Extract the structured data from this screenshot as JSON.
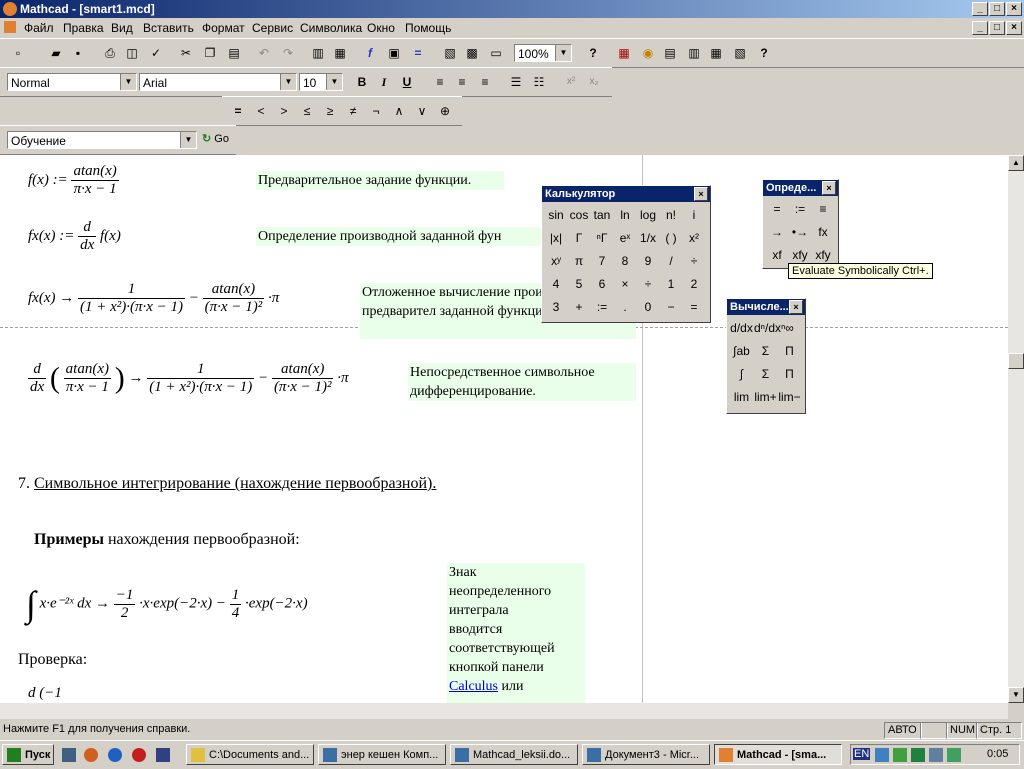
{
  "window": {
    "title": "Mathcad - [smart1.mcd]",
    "min": "_",
    "max": "□",
    "close": "×"
  },
  "menu": [
    "Файл",
    "Правка",
    "Вид",
    "Вставить",
    "Формат",
    "Сервис",
    "Символика",
    "Окно",
    "Помощь"
  ],
  "toolbar": {
    "zoom": "100%",
    "style": "Normal",
    "font": "Arial",
    "size": "10",
    "bold": "B",
    "italic": "I",
    "underline": "U",
    "ops": [
      "=",
      "<",
      ">",
      "≤",
      "≥",
      "≠",
      "¬",
      "∧",
      "∨",
      "⊕"
    ],
    "resource": "Обучение",
    "go": "Go"
  },
  "doc": {
    "eq1": "f(x) :=",
    "eq1_num": "atan(x)",
    "eq1_den": "π·x − 1",
    "note1": "Предварительное задание функции.",
    "eq2_lhs": "fx(x) :=",
    "eq2_num": "d",
    "eq2_den": "dx",
    "eq2_rhs": "f(x)",
    "note2": "Определение производной заданной фун",
    "eq3_lhs": "fx(x) →",
    "eq3_t1n": "1",
    "eq3_t1d": "(1 + x²)·(π·x − 1)",
    "eq3_minus": "−",
    "eq3_t2n": "atan(x)",
    "eq3_t2d": "(π·x − 1)²",
    "eq3_tail": "·π",
    "note3": "Отложенное вычисление производной предварител заданной функции.",
    "eq4_dn": "d",
    "eq4_dd": "dx",
    "eq4_in_n": "atan(x)",
    "eq4_in_d": "π·x − 1",
    "eq4_arrow": "→",
    "note4": "Непосредственное символьное дифференцирование.",
    "section_num": "7.",
    "section_title": "Символьное интегрирование (нахождение первообразной).",
    "examples_bold": "Примеры",
    "examples_rest": "нахождения первообразной:",
    "integral": "∫",
    "int_body": "x·e⁻²ˣ dx →",
    "int_r1n": "−1",
    "int_r1d": "2",
    "int_r1t": "·x·exp(−2·x) −",
    "int_r2n": "1",
    "int_r2d": "4",
    "int_r2t": "·exp(−2·x)",
    "note5_lines": [
      "Знак",
      "неопределенного",
      "интеграла",
      "вводится",
      "соответствующей",
      "кнопкой панели"
    ],
    "note5_link": "Calculus",
    "note5_after": "или",
    "check": "Проверка:"
  },
  "calc": {
    "title": "Калькулятор",
    "rows": [
      [
        "sin",
        "cos",
        "tan",
        "ln",
        "log",
        "n!",
        "i"
      ],
      [
        "|x|",
        "Γ",
        "ⁿΓ",
        "eˣ",
        "1/x",
        "( )",
        "x²"
      ],
      [
        "xʸ",
        "π",
        "7",
        "8",
        "9",
        "/",
        "÷"
      ],
      [
        "4",
        "5",
        "6",
        "×",
        "÷",
        "1",
        "2"
      ],
      [
        "3",
        "+",
        ":=",
        ".",
        "0",
        "−",
        "="
      ]
    ]
  },
  "defpal": {
    "title": "Опреде...",
    "rows": [
      [
        "=",
        ":=",
        "≡"
      ],
      [
        "→",
        "•→",
        "fx"
      ],
      [
        "xf",
        "xfy",
        "xfy"
      ]
    ]
  },
  "calcpal": {
    "title": "Вычисле...",
    "rows": [
      [
        "d/dx",
        "dⁿ/dxⁿ",
        "∞"
      ],
      [
        "∫ab",
        "Σ",
        "Π"
      ],
      [
        "∫",
        "Σ",
        "Π"
      ],
      [
        "lim",
        "lim+",
        "lim−"
      ]
    ]
  },
  "tooltip": "Evaluate Symbolically Ctrl+.",
  "status": {
    "help": "Нажмите F1 для получения справки.",
    "mode": "АВТО",
    "num": "NUM",
    "page": "Стр. 1"
  },
  "taskbar": {
    "start": "Пуск",
    "tasks": [
      "C:\\Documents and...",
      "энер кешен Комп...",
      "Mathcad_leksii.do...",
      "Документ3 - Micr...",
      "Mathcad - [sma..."
    ],
    "lang": "EN",
    "time": "0:05"
  }
}
